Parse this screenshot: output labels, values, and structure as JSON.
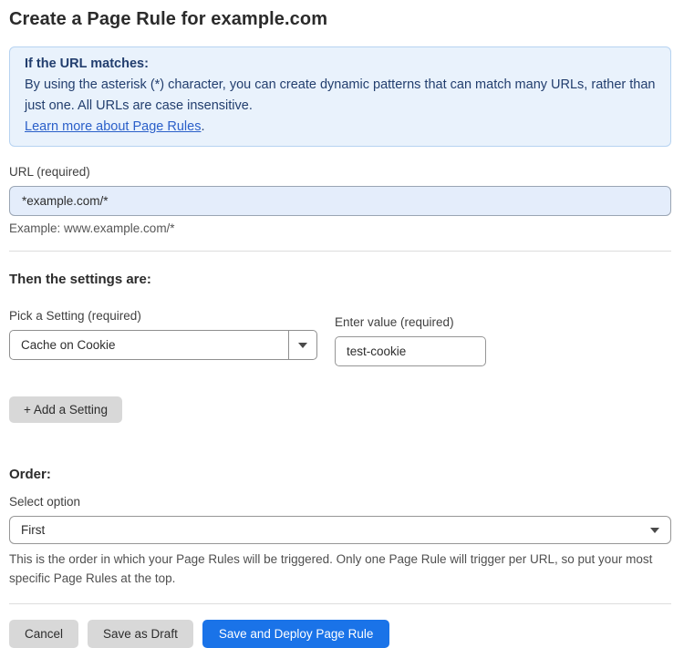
{
  "page": {
    "title": "Create a Page Rule for example.com"
  },
  "info_box": {
    "heading": "If the URL matches:",
    "body": "By using the asterisk (*) character, you can create dynamic patterns that can match many URLs, rather than just one. All URLs are case insensitive.",
    "link_label": "Learn more about Page Rules",
    "link_suffix": "."
  },
  "url_field": {
    "label": "URL (required)",
    "value": "*example.com/*",
    "hint": "Example: www.example.com/*"
  },
  "settings_section": {
    "heading": "Then the settings are:",
    "setting_picker": {
      "label": "Pick a Setting (required)",
      "selected": "Cache on Cookie"
    },
    "value_field": {
      "label": "Enter value (required)",
      "value": "test-cookie"
    },
    "add_setting_label": "+ Add a Setting"
  },
  "order_section": {
    "heading": "Order:",
    "select_label": "Select option",
    "selected": "First",
    "help": "This is the order in which your Page Rules will be triggered. Only one Page Rule will trigger per URL, so put your most specific Page Rules at the top."
  },
  "footer": {
    "cancel_label": "Cancel",
    "save_draft_label": "Save as Draft",
    "save_deploy_label": "Save and Deploy Page Rule"
  },
  "colors": {
    "accent_blue": "#1a73e8",
    "info_box_bg": "#e9f2fc",
    "info_box_border": "#b7d3f1",
    "info_text": "#223e6e",
    "link_blue": "#2a5fc9",
    "url_input_bg": "#e4edfb",
    "gray_button_bg": "#d8d8d8"
  },
  "icons": {
    "setting_select_caret": "caret-down-icon",
    "order_select_caret": "caret-down-icon"
  }
}
